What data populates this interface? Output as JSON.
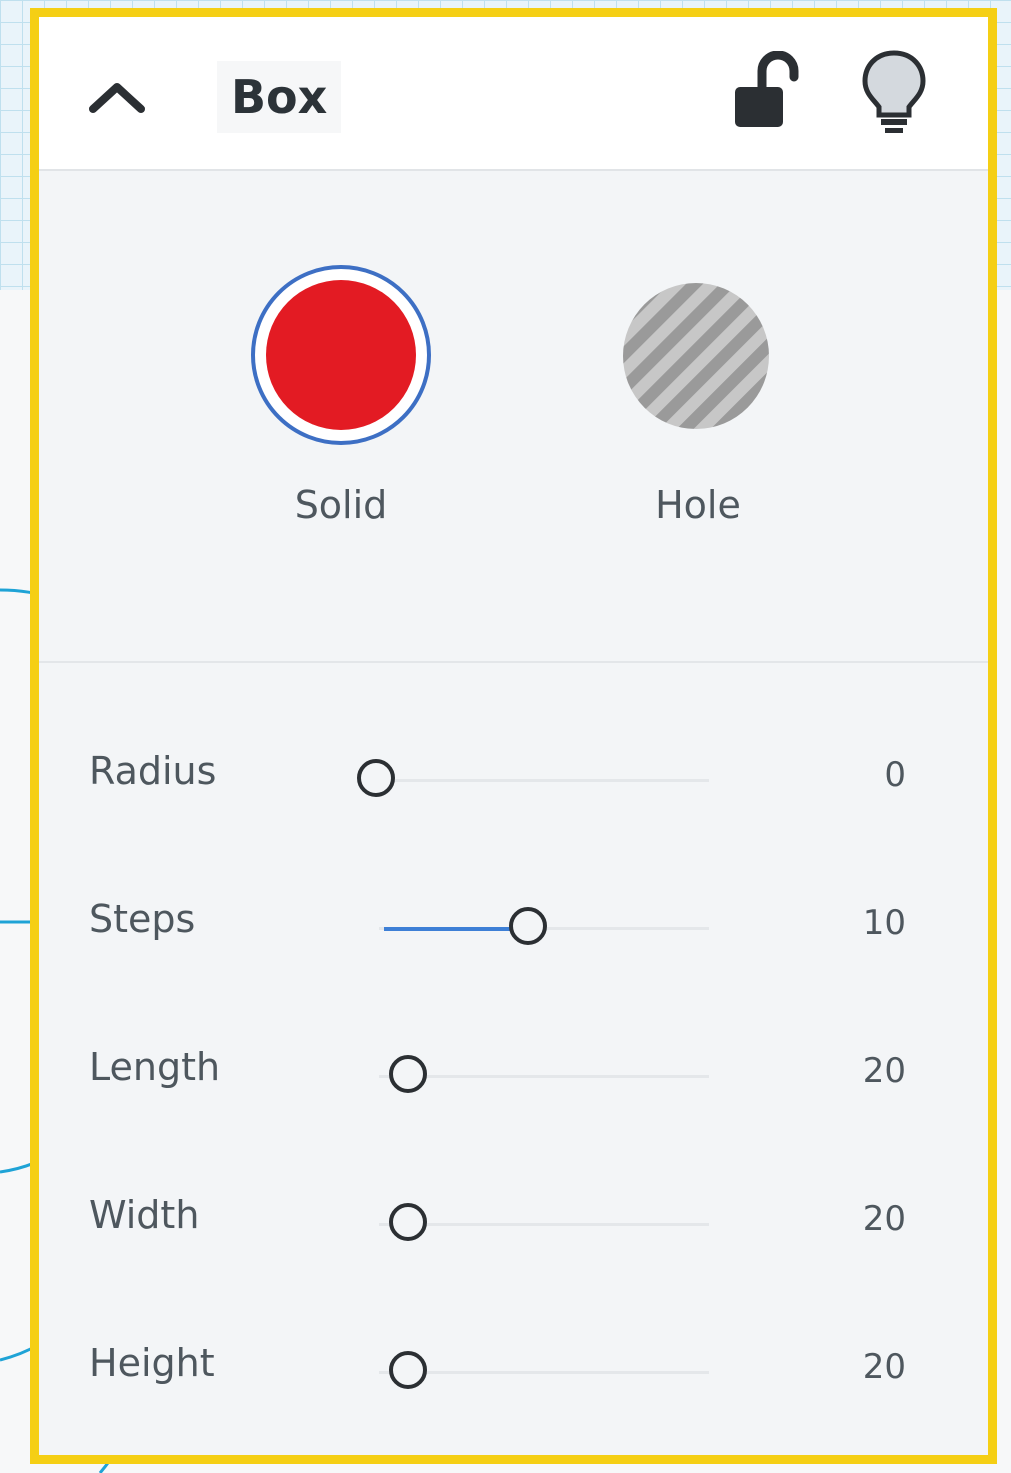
{
  "panel": {
    "title": "Box",
    "icons": {
      "collapse": "chevron-up-icon",
      "lock": "unlock-icon",
      "visibility": "lightbulb-icon"
    },
    "border_color": "#f5cf14"
  },
  "shape_type": {
    "options": [
      {
        "label": "Solid",
        "color": "#e31b23",
        "selected": true
      },
      {
        "label": "Hole",
        "color": "#a9a9a9",
        "selected": false
      }
    ]
  },
  "properties": [
    {
      "label": "Radius",
      "value": "0",
      "fill_fraction": 0.0
    },
    {
      "label": "Steps",
      "value": "10",
      "fill_fraction": 0.38
    },
    {
      "label": "Length",
      "value": "20",
      "fill_fraction": 0.0
    },
    {
      "label": "Width",
      "value": "20",
      "fill_fraction": 0.0
    },
    {
      "label": "Height",
      "value": "20",
      "fill_fraction": 0.0
    }
  ],
  "colors": {
    "accent": "#3d7fd6",
    "callout": "#1fa3d6"
  }
}
